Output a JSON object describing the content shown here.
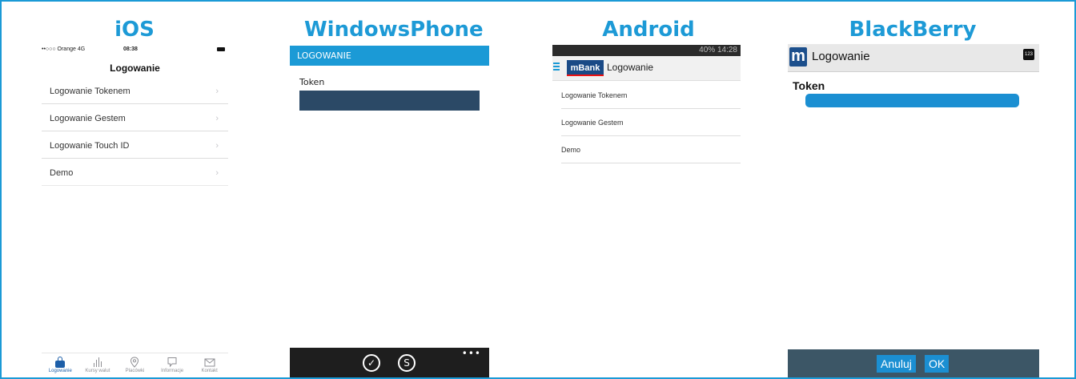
{
  "platforms": {
    "ios": {
      "heading": "iOS",
      "status": {
        "carrier": "••○○○ Orange  4G",
        "time": "08:38"
      },
      "screen_title": "Logowanie",
      "items": [
        {
          "label": "Logowanie Tokenem"
        },
        {
          "label": "Logowanie Gestem"
        },
        {
          "label": "Logowanie Touch ID"
        },
        {
          "label": "Demo"
        }
      ],
      "tabs": [
        {
          "label": "Logowanie",
          "icon": "lock-icon"
        },
        {
          "label": "Kursy walut",
          "icon": "bar-chart-icon"
        },
        {
          "label": "Placówki",
          "icon": "location-pin-icon"
        },
        {
          "label": "Informacje",
          "icon": "chat-icon"
        },
        {
          "label": "Kontakt",
          "icon": "mail-icon"
        }
      ]
    },
    "windowsphone": {
      "heading": "WindowsPhone",
      "screen_title": "LOGOWANIE",
      "token_label": "Token",
      "token_value": "",
      "appbar_dots": "•••"
    },
    "android": {
      "heading": "Android",
      "status_text": "40% 14:28",
      "brand": "mBank",
      "screen_title": "Logowanie",
      "items": [
        {
          "label": "Logowanie Tokenem"
        },
        {
          "label": "Logowanie Gestem"
        },
        {
          "label": "Demo"
        }
      ]
    },
    "blackberry": {
      "heading": "BlackBerry",
      "logo_letter": "m",
      "screen_title": "Logowanie",
      "keyboard_badge": "123",
      "token_label": "Token",
      "token_value": "",
      "cancel_label": "Anuluj",
      "ok_label": "OK"
    }
  },
  "colors": {
    "accent": "#1b9ad6",
    "wp_input": "#2b4966",
    "bb_bottom": "#3c5666",
    "mbank_blue": "#1a4a86"
  }
}
